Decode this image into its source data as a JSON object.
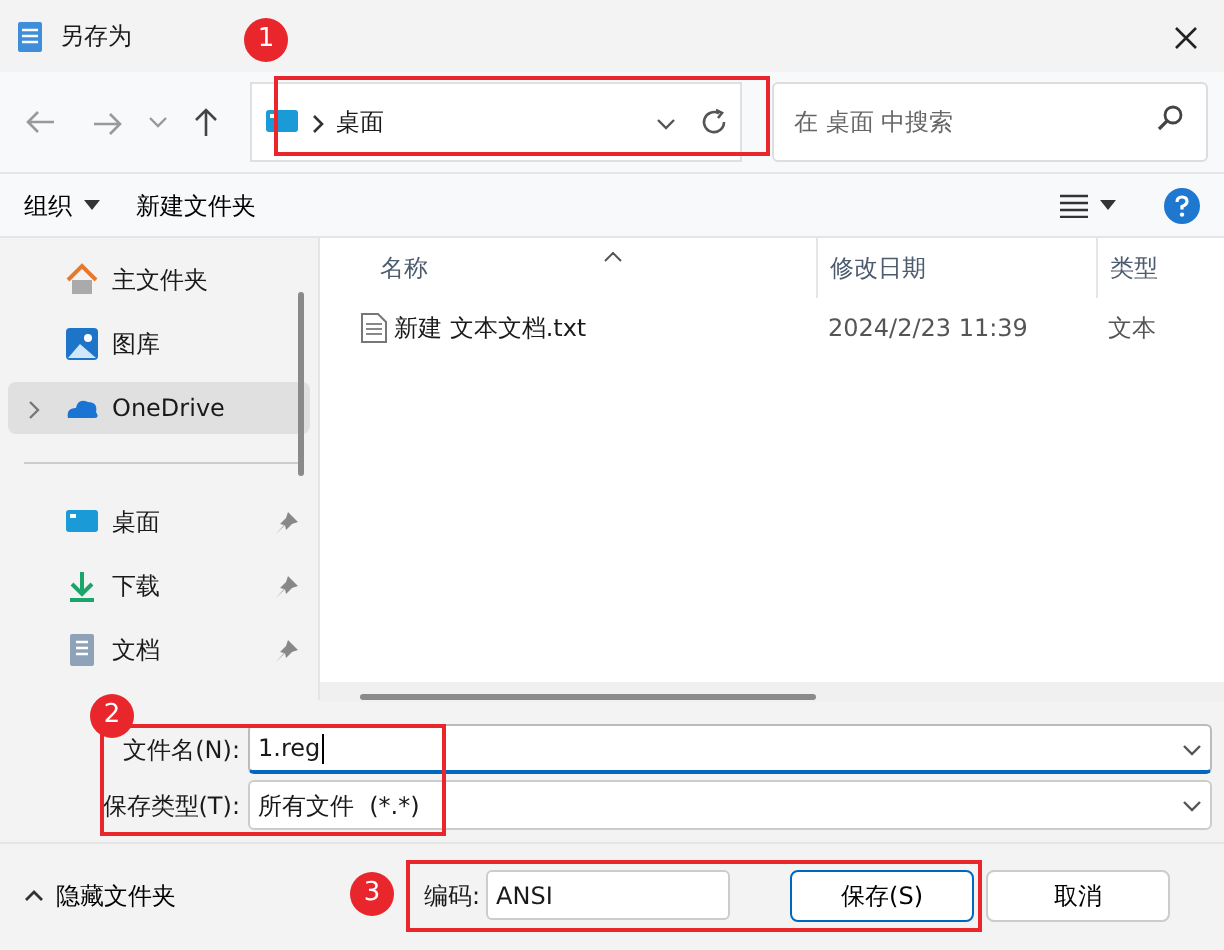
{
  "window": {
    "title": "另存为"
  },
  "address": {
    "path": [
      "桌面"
    ]
  },
  "search": {
    "placeholder": "在 桌面 中搜索"
  },
  "toolbar": {
    "organize": "组织",
    "new_folder": "新建文件夹"
  },
  "sidebar": {
    "sections": [
      {
        "items": [
          {
            "label": "主文件夹",
            "kind": "home",
            "pinned": false,
            "selected": false,
            "expandable": false
          },
          {
            "label": "图库",
            "kind": "gallery",
            "pinned": false,
            "selected": false,
            "expandable": false
          },
          {
            "label": "OneDrive",
            "kind": "cloud",
            "pinned": false,
            "selected": true,
            "expandable": true
          }
        ]
      },
      {
        "items": [
          {
            "label": "桌面",
            "kind": "desktop",
            "pinned": true,
            "selected": false,
            "expandable": false
          },
          {
            "label": "下载",
            "kind": "download",
            "pinned": true,
            "selected": false,
            "expandable": false
          },
          {
            "label": "文档",
            "kind": "document",
            "pinned": true,
            "selected": false,
            "expandable": false
          }
        ]
      }
    ]
  },
  "files": {
    "columns": [
      "名称",
      "修改日期",
      "类型"
    ],
    "rows": [
      {
        "name": "新建 文本文档.txt",
        "modified": "2024/2/23 11:39",
        "type": "文本"
      }
    ]
  },
  "form": {
    "file_name": {
      "label": "文件名(N):",
      "value": "1.reg"
    },
    "file_type": {
      "label": "保存类型(T):",
      "value": "所有文件  (*.*)"
    }
  },
  "footer": {
    "hide_folders": "隐藏文件夹",
    "encoding": {
      "label": "编码:",
      "value": "ANSI"
    },
    "buttons": [
      {
        "label": "保存(S)",
        "primary": true
      },
      {
        "label": "取消",
        "primary": false
      }
    ]
  },
  "annotations": [
    {
      "number": "1"
    },
    {
      "number": "2"
    },
    {
      "number": "3"
    }
  ]
}
